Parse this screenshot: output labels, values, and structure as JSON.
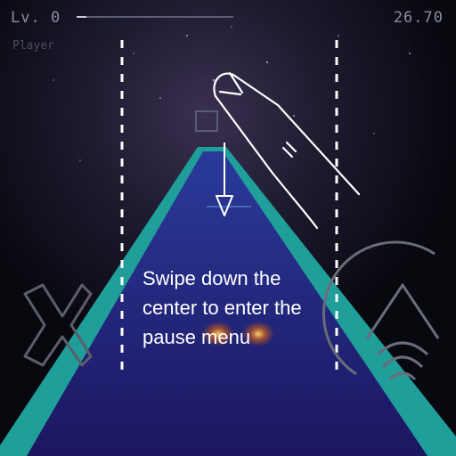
{
  "hud": {
    "level_label": "Lv. 0",
    "player_tag": "P",
    "player_name": "Player",
    "time": "26.70",
    "progress": 0.06
  },
  "tutorial": {
    "text": "Swipe down the\ncenter to enter the\npause menu",
    "gesture": "swipe-down",
    "icons": [
      "hand-pointer-icon",
      "down-arrow-icon"
    ]
  },
  "controls": {
    "left_icon": "x-cross-icon",
    "right_icon": "jump-chevron-icon"
  },
  "colors": {
    "track_edge": "#1f9e9a",
    "track_fill": "#1b1a6e",
    "hud_text": "#8a8ba4",
    "tutorial_text": "#ffffff"
  }
}
